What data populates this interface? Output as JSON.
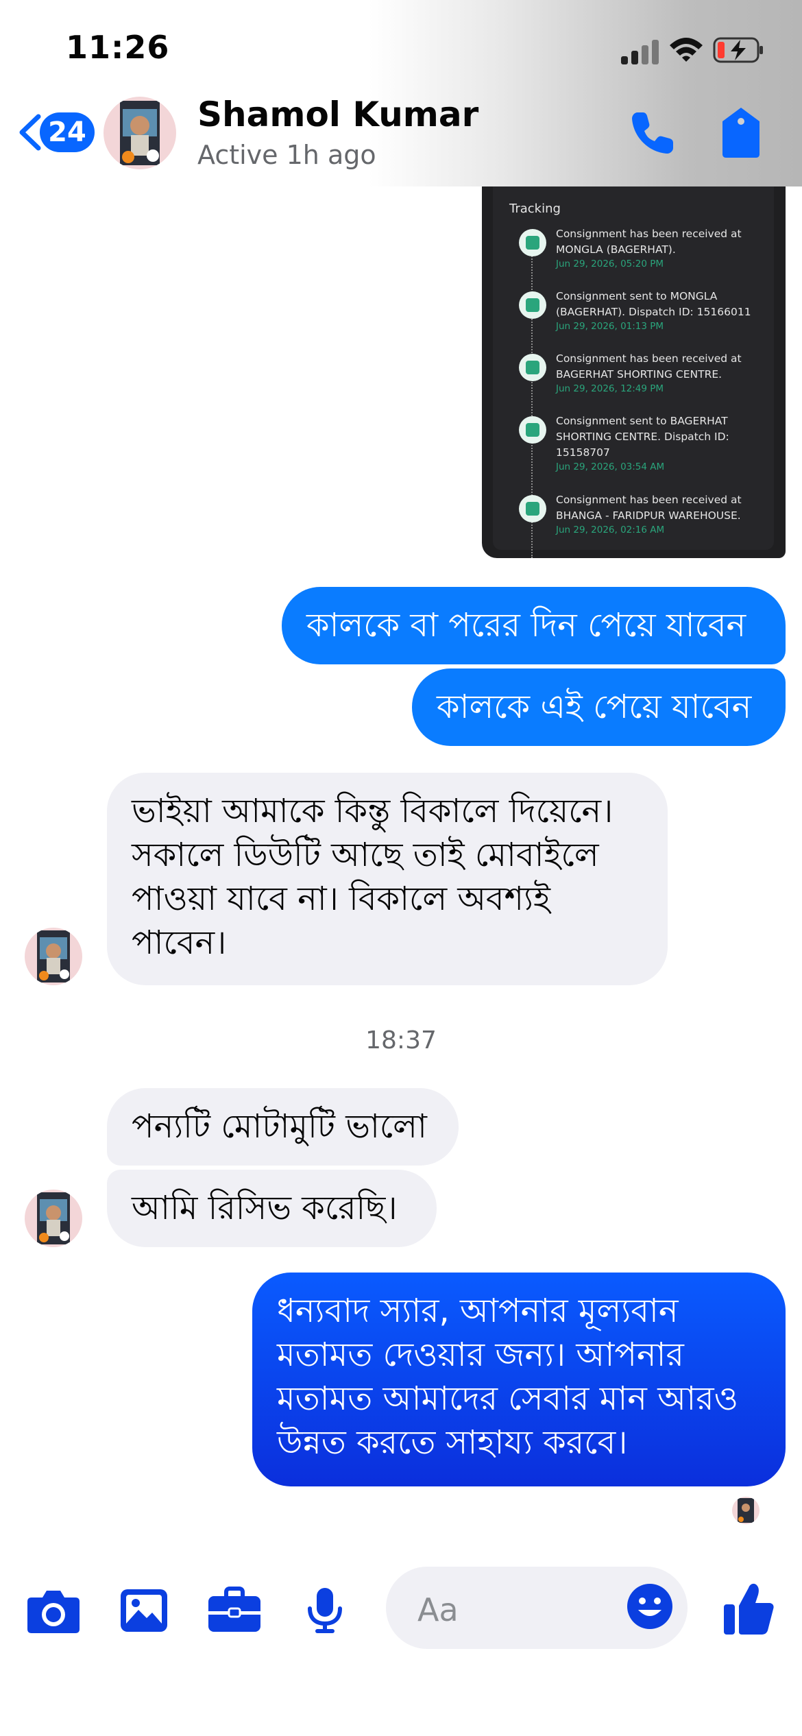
{
  "status_bar": {
    "time": "11:26"
  },
  "header": {
    "back_badge": "24",
    "contact_name": "Shamol Kumar",
    "contact_status": "Active 1h ago"
  },
  "tracking_image": {
    "title": "Tracking",
    "events": [
      {
        "text": "Consignment has been received at MONGLA (BAGERHAT).",
        "date": "Jun 29, 2026, 05:20 PM"
      },
      {
        "text": "Consignment sent to MONGLA (BAGERHAT).  Dispatch ID: 15166011",
        "date": "Jun 29, 2026, 01:13 PM"
      },
      {
        "text": "Consignment has been received at BAGERHAT SHORTING CENTRE.",
        "date": "Jun 29, 2026, 12:49 PM"
      },
      {
        "text": "Consignment sent to BAGERHAT SHORTING CENTRE.  Dispatch ID: 15158707",
        "date": "Jun 29, 2026, 03:54 AM"
      },
      {
        "text": "Consignment has been received at BHANGA - FARIDPUR WAREHOUSE.",
        "date": "Jun 29, 2026, 02:16 AM"
      }
    ]
  },
  "messages": [
    {
      "text": "কালকে বা পরের দিন পেয়ে যাবেন"
    },
    {
      "text": "কালকে এই পেয়ে যাবেন"
    },
    {
      "text": "ভাইয়া আমাকে কিন্তু বিকালে দিয়েনে। সকালে ডিউটি আছে তাই মোবাইলে পাওয়া যাবে না। বিকালে অবশ্যই পাবেন।"
    },
    {
      "text": "পন্যটি মোটামুটি ভালো"
    },
    {
      "text": "আমি রিসিভ করেছি।"
    },
    {
      "text": "ধন্যবাদ স্যার, আপনার মূল্যবান মতামত দেওয়ার জন্য। আপনার মতামত আমাদের সেবার মান আরও উন্নত করতে সাহায্য করবে।"
    }
  ],
  "timestamp": "18:37",
  "composer": {
    "placeholder": "Aa"
  },
  "colors": {
    "accent": "#0866ff",
    "outgoing": "#0a7cff",
    "incoming": "#f0f0f5"
  }
}
